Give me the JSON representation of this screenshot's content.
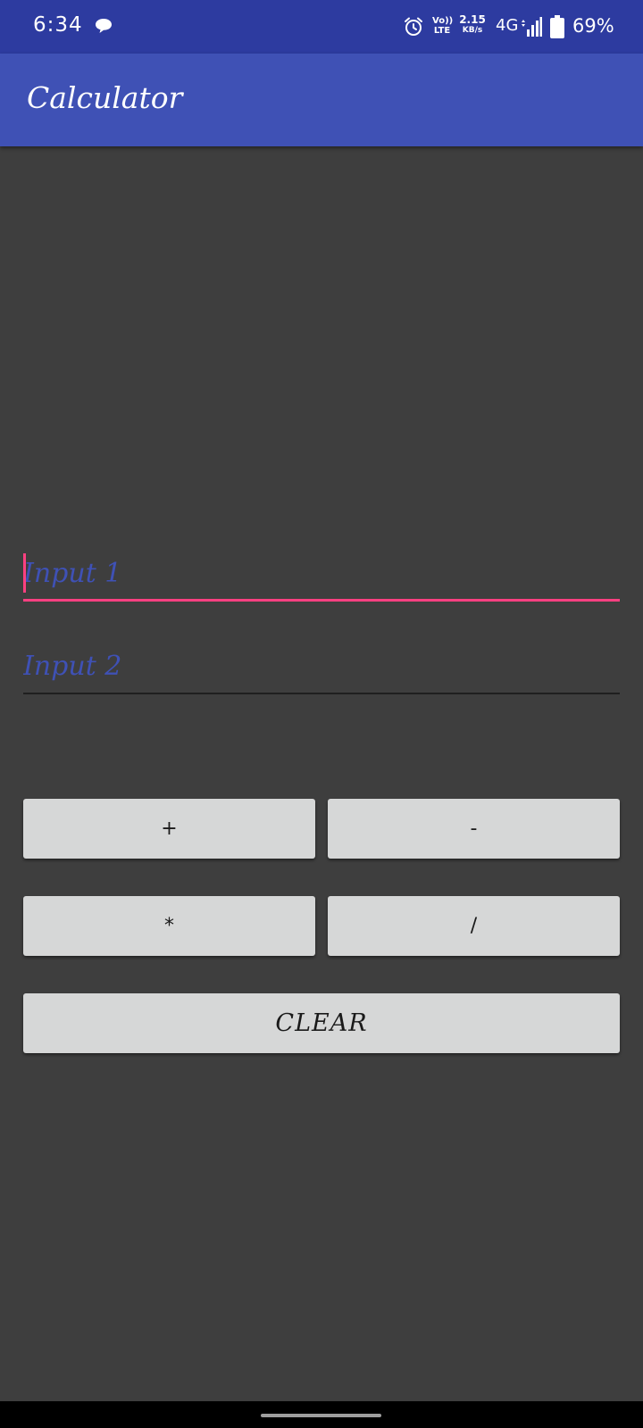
{
  "status_bar": {
    "time": "6:34",
    "message_icon": "chat-bubble-icon",
    "alarm_icon": "alarm-icon",
    "volte_line1": "Vo))",
    "volte_line2": "LTE",
    "speed_value": "2.15",
    "speed_unit": "KB/s",
    "network": "4G",
    "signal_icon": "signal-bars-icon",
    "battery_icon": "battery-icon",
    "battery_percent": "69%"
  },
  "app_bar": {
    "title": "Calculator",
    "color": "#3f51b5"
  },
  "form": {
    "input1_placeholder": "Input 1",
    "input1_value": "",
    "input2_placeholder": "Input 2",
    "input2_value": "",
    "accent_color": "#ff4081"
  },
  "buttons": {
    "add": "+",
    "subtract": "-",
    "multiply": "*",
    "divide": "/",
    "clear": "CLEAR"
  }
}
